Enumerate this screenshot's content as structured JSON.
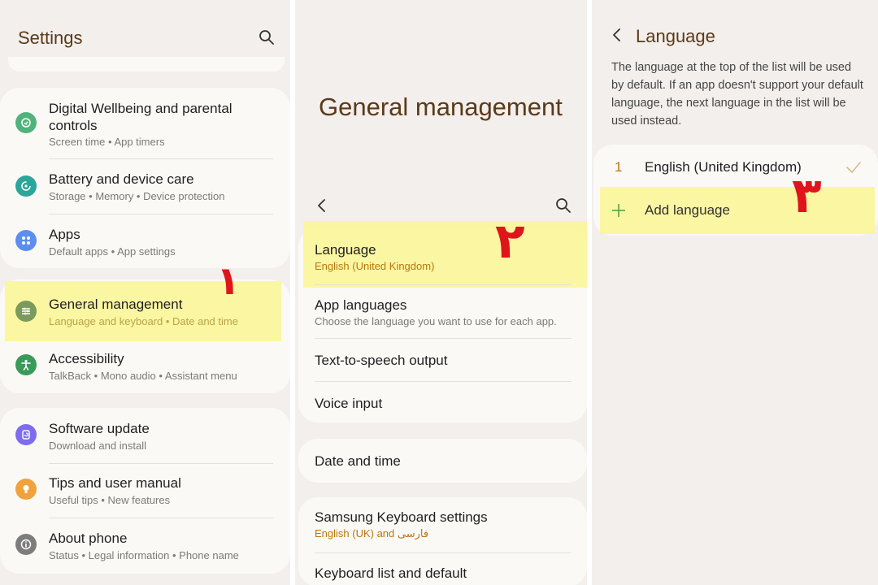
{
  "settings": {
    "title": "Settings",
    "items": [
      {
        "title": "Digital Wellbeing and parental controls",
        "sub": [
          "Screen time",
          "App timers"
        ]
      },
      {
        "title": "Battery and device care",
        "sub": [
          "Storage",
          "Memory",
          "Device protection"
        ]
      },
      {
        "title": "Apps",
        "sub": [
          "Default apps",
          "App settings"
        ]
      },
      {
        "title": "General management",
        "sub": [
          "Language and keyboard",
          "Date and time"
        ]
      },
      {
        "title": "Accessibility",
        "sub": [
          "TalkBack",
          "Mono audio",
          "Assistant menu"
        ]
      },
      {
        "title": "Software update",
        "sub": [
          "Download and install"
        ]
      },
      {
        "title": "Tips and user manual",
        "sub": [
          "Useful tips",
          "New features"
        ]
      },
      {
        "title": "About phone",
        "sub": [
          "Status",
          "Legal information",
          "Phone name"
        ]
      }
    ],
    "icons": [
      "wellbeing-icon",
      "battery-care-icon",
      "apps-icon",
      "general-management-icon",
      "accessibility-icon",
      "software-update-icon",
      "tips-icon",
      "about-phone-icon"
    ],
    "icon_colors": [
      "#4fb37a",
      "#2aa69a",
      "#5b8ef0",
      "#7a9b5c",
      "#3a9a5a",
      "#7b6cf0",
      "#f2a23c",
      "#7d7d7d"
    ],
    "step_marker": "١"
  },
  "general": {
    "title": "General management",
    "items": [
      {
        "title": "Language",
        "sub": "English (United Kingdom)"
      },
      {
        "title": "App languages",
        "sub": "Choose the language you want to use for each app."
      },
      {
        "title": "Text-to-speech output"
      },
      {
        "title": "Voice input"
      },
      {
        "title": "Date and time"
      },
      {
        "title": "Samsung Keyboard settings",
        "sub": "English (UK) and فارسی"
      },
      {
        "title": "Keyboard list and default"
      }
    ],
    "step_marker": "٢"
  },
  "language": {
    "title": "Language",
    "description": "The language at the top of the list will be used by default. If an app doesn't support your default language, the next language in the list will be used instead.",
    "list": [
      {
        "number": "1",
        "name": "English (United Kingdom)"
      }
    ],
    "add_label": "Add language",
    "step_marker": "٣"
  },
  "colors": {
    "accent": "#5b3a1a",
    "highlight": "#fbf59a",
    "marker": "#e0141b",
    "sub_orange": "#b8770f"
  }
}
